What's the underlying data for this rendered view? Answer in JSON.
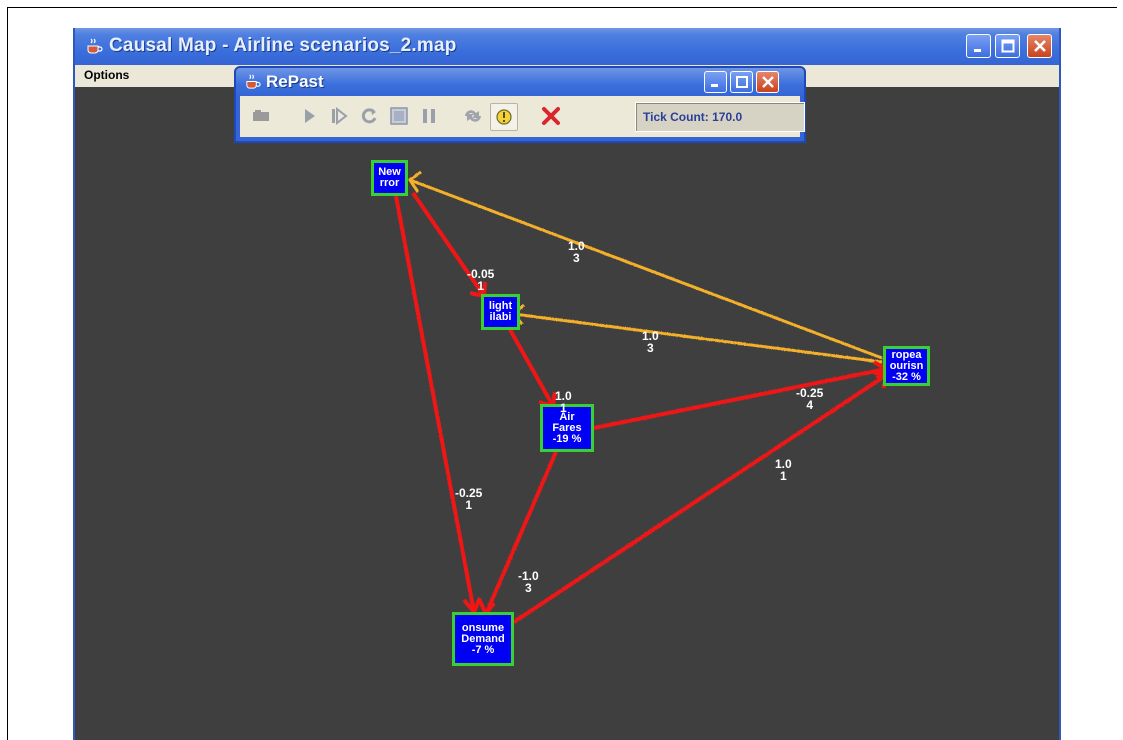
{
  "main_window": {
    "title": "Causal Map - Airline scenarios_2.map",
    "menu": [
      "Options"
    ]
  },
  "repast": {
    "title": "RePast",
    "toolbar_icons": [
      "setup-icon",
      "play-icon",
      "step-icon",
      "reset-icon",
      "stop-icon",
      "pause-icon",
      "load-icon",
      "parameters-icon",
      "exit-icon"
    ],
    "tick_count_label": "Tick Count: 170.0"
  },
  "nodes": {
    "terror": {
      "line1": "New",
      "line2": "rror"
    },
    "flights": {
      "line1": "light",
      "line2": "ilabi"
    },
    "fares": {
      "line1": "Air",
      "line2": "Fares",
      "line3": "-19 %"
    },
    "tourism": {
      "line1": "ropea",
      "line2": "ourisn",
      "line3": "-32 %"
    },
    "demand": {
      "line1": "onsume",
      "line2": "Demand",
      "line3": "-7 %"
    }
  },
  "edges": {
    "tourism_terror": {
      "weight": "1.0",
      "lag": "3"
    },
    "tourism_flights": {
      "weight": "1.0",
      "lag": "3"
    },
    "terror_flights": {
      "weight": "-0.05",
      "lag": "1"
    },
    "flights_fares": {
      "weight": "1.0",
      "lag": "1"
    },
    "fares_tourism": {
      "weight": "-0.25",
      "lag": "4"
    },
    "demand_tourism": {
      "weight": "1.0",
      "lag": "1"
    },
    "terror_demand": {
      "weight": "-0.25",
      "lag": "1"
    },
    "fares_demand": {
      "weight": "-1.0",
      "lag": "3"
    }
  },
  "colors": {
    "positive_link": "#f5b02a",
    "negative_link": "#f01818",
    "node_fill": "#0000f5",
    "node_border": "#39d130"
  }
}
